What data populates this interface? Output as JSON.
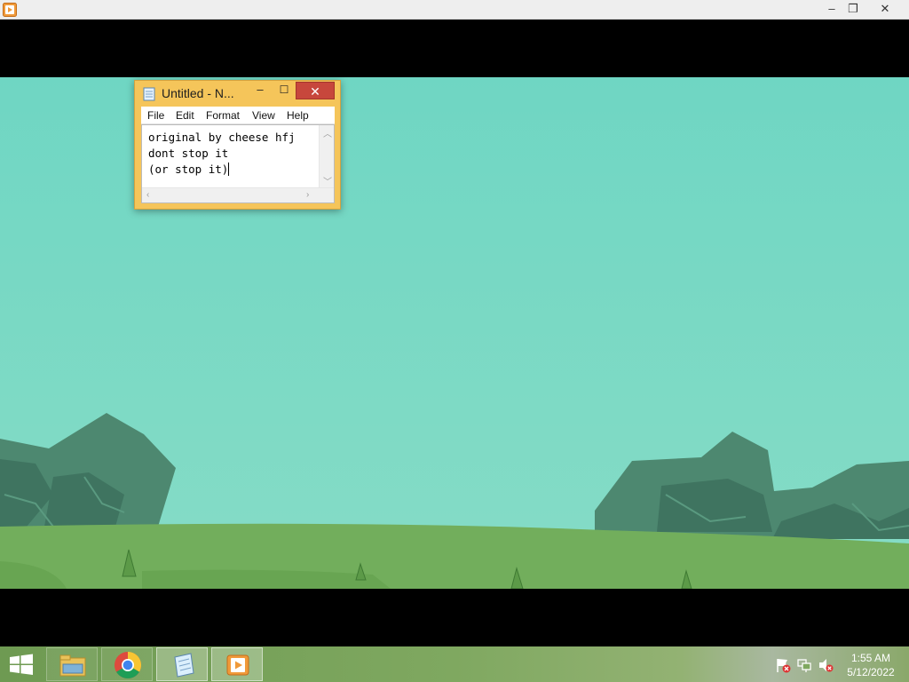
{
  "player": {
    "icon": "media-player-icon",
    "controls": {
      "minimize": "–",
      "restore": "❐",
      "close": "✕"
    }
  },
  "notepad": {
    "title": "Untitled - N...",
    "controls": {
      "minimize": "–",
      "maximize": "☐",
      "close": "✕"
    },
    "menu": [
      "File",
      "Edit",
      "Format",
      "View",
      "Help"
    ],
    "text": "original by cheese hfj\ndont stop it\n(or stop it)"
  },
  "taskbar": {
    "items": [
      {
        "name": "file-explorer",
        "icon": "folder-icon"
      },
      {
        "name": "chrome",
        "icon": "chrome-icon"
      },
      {
        "name": "notepad",
        "icon": "notepad-icon"
      },
      {
        "name": "media-player",
        "icon": "media-player-icon"
      }
    ],
    "tray": [
      "action-center-flag-icon",
      "network-icon",
      "volume-muted-icon"
    ],
    "clock": {
      "time": "1:55 AM",
      "date": "5/12/2022"
    }
  },
  "colors": {
    "sky": "#7dd8c4",
    "hills": "#4e8a70",
    "grass": "#6fae5a",
    "notepad_frame": "#f5c55a",
    "close_red": "#c7473c"
  }
}
